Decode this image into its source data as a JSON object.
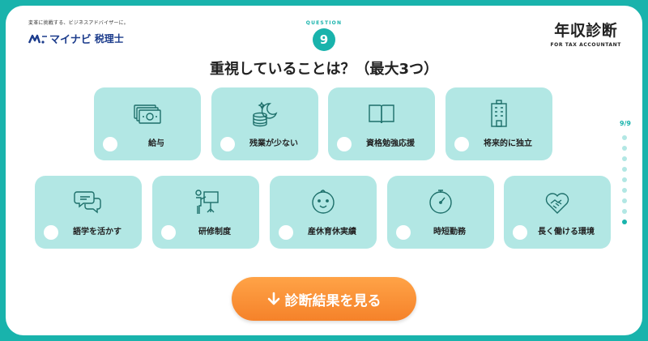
{
  "header": {
    "logo_tagline": "変革に挑戦する、ビジネスアドバイザーに。",
    "logo_name": "マイナビ",
    "logo_sub": "税理士",
    "brand_title": "年収診断",
    "brand_sub": "FOR TAX ACCOUNTANT"
  },
  "question": {
    "label": "QUESTION",
    "number": "9",
    "text": "重視していることは？（最大3つ）"
  },
  "options": [
    {
      "label": "給与",
      "icon": "money-icon"
    },
    {
      "label": "残業が少ない",
      "icon": "moon-coins-icon"
    },
    {
      "label": "資格勉強応援",
      "icon": "book-icon"
    },
    {
      "label": "将来的に独立",
      "icon": "building-icon"
    },
    {
      "label": "語学を活かす",
      "icon": "speech-bubbles-icon"
    },
    {
      "label": "研修制度",
      "icon": "presentation-icon"
    },
    {
      "label": "産休育休実績",
      "icon": "baby-icon"
    },
    {
      "label": "時短勤務",
      "icon": "clock-icon"
    },
    {
      "label": "長く働ける環境",
      "icon": "handshake-heart-icon"
    }
  ],
  "progress": {
    "text": "9/9",
    "current": 9,
    "total": 9
  },
  "cta": {
    "label": "診断結果を見る",
    "icon": "arrow-down-icon"
  },
  "colors": {
    "accent": "#19b3ac",
    "card": "#b2e7e4",
    "cta": "#f5822a",
    "brand_blue": "#1c3c8c"
  }
}
